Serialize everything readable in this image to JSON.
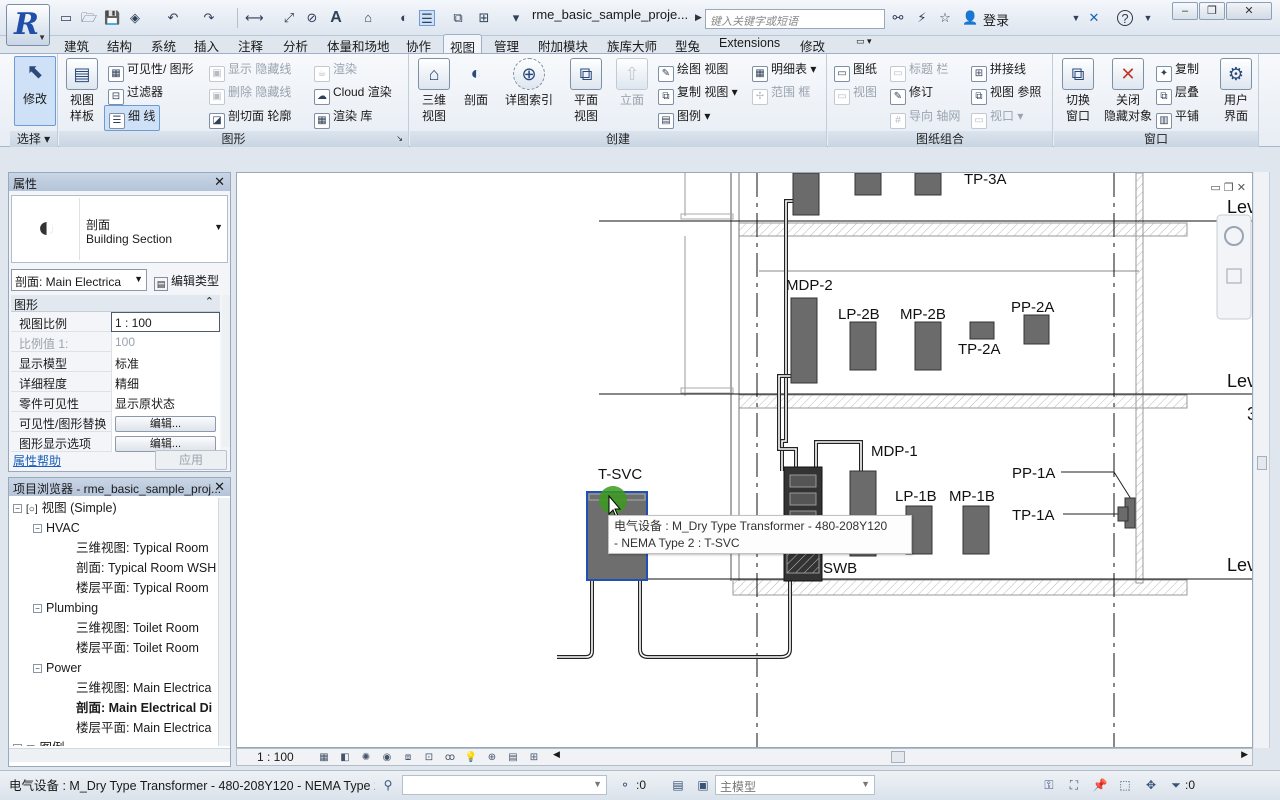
{
  "quick_access": {
    "doc_title": "rme_basic_sample_proje...",
    "search_placeholder": "键入关键字或短语",
    "login": "登录"
  },
  "tabs": [
    "建筑",
    "结构",
    "系统",
    "插入",
    "注释",
    "分析",
    "体量和场地",
    "协作",
    "视图",
    "管理",
    "附加模块",
    "族库大师",
    "型兔",
    "Extensions",
    "修改"
  ],
  "active_tab": "视图",
  "ribbon": {
    "select": {
      "modify": "修改",
      "panel": "选择"
    },
    "graphics": {
      "view_template": "视图\n样板",
      "visibility_graphics": "可见性/ 图形",
      "filters": "过滤器",
      "thin_lines": "细 线",
      "show_hidden": "显示 隐藏线",
      "remove_hidden": "删除 隐藏线",
      "cut_profile": "剖切面 轮廓",
      "render": "渲染",
      "cloud_render": "Cloud  渲染",
      "render_gallery": "渲染  库",
      "panel": "图形"
    },
    "create": {
      "three_d": "三维\n视图",
      "section": "剖面",
      "callout": "详图索引",
      "plan_views": "平面\n视图",
      "elevation": "立面",
      "drafting_view": "绘图 视图",
      "duplicate_view": "复制 视图",
      "legends": "图例",
      "schedules": "明细表",
      "scope_box": "范围 框",
      "panel": "创建"
    },
    "sheet": {
      "sheet": "图纸",
      "title_block": "标题 栏",
      "matchline": "拼接线",
      "view": "视图",
      "revisions": "修订",
      "view_reference": "视图 参照",
      "guide_grid": "导向 轴网",
      "viewports": "视口",
      "panel": "图纸组合"
    },
    "windows": {
      "switch": "切换\n窗口",
      "close_hidden": "关闭\n隐藏对象",
      "replicate": "复制",
      "cascade": "层叠",
      "tile": "平铺",
      "ui": "用户\n界面",
      "panel": "窗口"
    }
  },
  "properties": {
    "title": "属性",
    "type_family": "剖面",
    "type_name": "Building Section",
    "instance_dropdown": "剖面: Main Electrica",
    "edit_type": "编辑类型",
    "group": "图形",
    "rows": [
      {
        "name": "视图比例",
        "value": "1 : 100",
        "dim": false
      },
      {
        "name": "比例值 1:",
        "value": "100",
        "dim": true
      },
      {
        "name": "显示模型",
        "value": "标准",
        "dim": false
      },
      {
        "name": "详细程度",
        "value": "精细",
        "dim": false
      },
      {
        "name": "零件可见性",
        "value": "显示原状态",
        "dim": false
      },
      {
        "name": "可见性/图形替换",
        "value": "编辑...",
        "dim": false
      },
      {
        "name": "图形显示选项",
        "value": "编辑...",
        "dim": false
      }
    ],
    "help_link": "属性帮助",
    "apply": "应用"
  },
  "project_browser": {
    "title": "项目浏览器 - rme_basic_sample_proj...",
    "nodes": [
      {
        "text": "视图 (Simple)",
        "level": 0,
        "toggle": "−",
        "bold": false
      },
      {
        "text": "HVAC",
        "level": 1,
        "toggle": "−",
        "bold": false
      },
      {
        "text": "三维视图: Typical Room",
        "level": 2,
        "toggle": "",
        "bold": false
      },
      {
        "text": "剖面: Typical Room WSH",
        "level": 2,
        "toggle": "",
        "bold": false
      },
      {
        "text": "楼层平面: Typical Room",
        "level": 2,
        "toggle": "",
        "bold": false
      },
      {
        "text": "Plumbing",
        "level": 1,
        "toggle": "−",
        "bold": false
      },
      {
        "text": "三维视图: Toilet Room",
        "level": 2,
        "toggle": "",
        "bold": false
      },
      {
        "text": "楼层平面: Toilet Room",
        "level": 2,
        "toggle": "",
        "bold": false
      },
      {
        "text": "Power",
        "level": 1,
        "toggle": "−",
        "bold": false
      },
      {
        "text": "三维视图: Main Electrica",
        "level": 2,
        "toggle": "",
        "bold": false
      },
      {
        "text": "剖面: Main Electrical Di",
        "level": 2,
        "toggle": "",
        "bold": true
      },
      {
        "text": "楼层平面: Main Electrica",
        "level": 2,
        "toggle": "",
        "bold": false
      },
      {
        "text": "图例",
        "level": 0,
        "toggle": "+",
        "bold": false
      }
    ]
  },
  "drawing": {
    "labels": [
      "TP-3A",
      "MDP-2",
      "LP-2B",
      "MP-2B",
      "PP-2A",
      "TP-2A",
      "MDP-1",
      "LP-1B",
      "MP-1B",
      "PP-1A",
      "TP-1A",
      "T-SVC",
      "SWB"
    ],
    "level_tags": [
      "Lev",
      "Lev",
      "Lev"
    ],
    "level_tag_extra": "3",
    "tooltip_line1": "电气设备 : M_Dry Type Transformer - 480-208Y120",
    "tooltip_line2": "- NEMA Type 2 : T-SVC"
  },
  "view_bar": {
    "scale": "1 : 100"
  },
  "status_bar": {
    "text": "电气设备 : M_Dry Type Transformer - 480-208Y120 - NEMA Type 2 : T-SVC",
    "editable_count": ":0",
    "model": "主模型",
    "filter_count": ":0"
  }
}
